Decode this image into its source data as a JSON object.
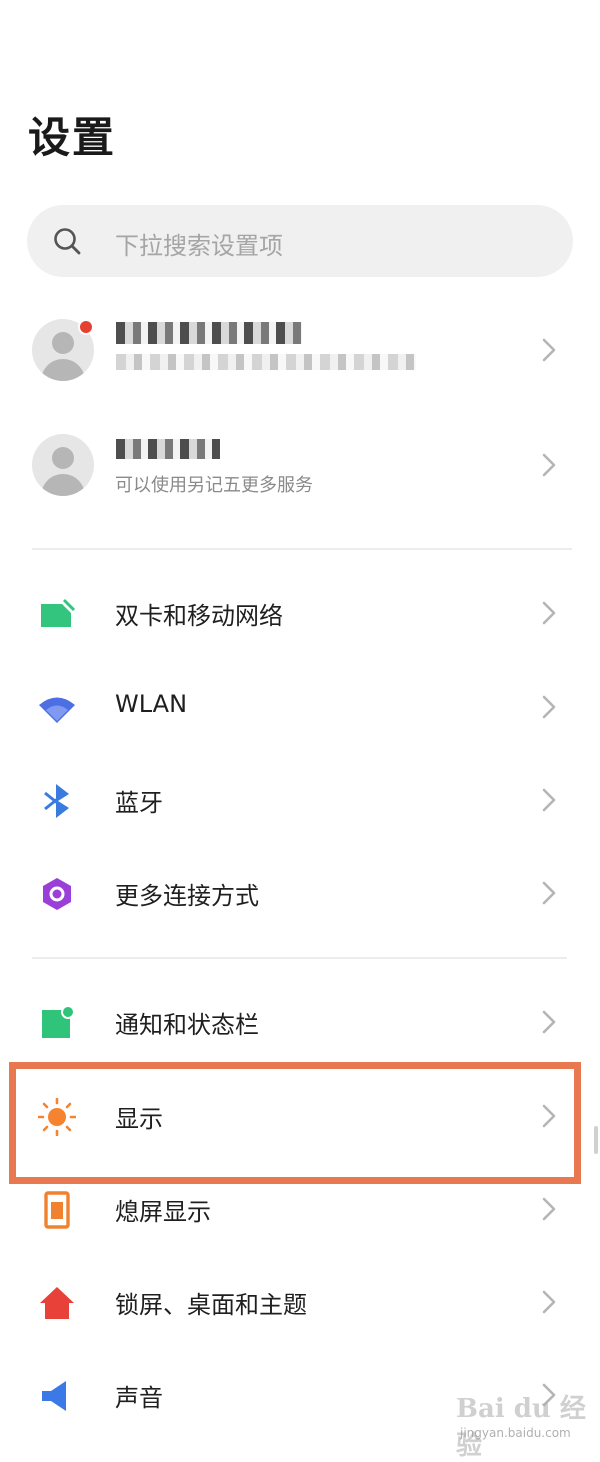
{
  "title": "设置",
  "search": {
    "placeholder": "下拉搜索设置项",
    "icon": "search-icon"
  },
  "accounts": [
    {
      "icon": "avatar",
      "has_notification": true
    },
    {
      "icon": "avatar",
      "subtitle": "可以使用另记五更多服务"
    }
  ],
  "section1": [
    {
      "label": "双卡和移动网络",
      "icon": "sim-card-icon",
      "color": "#33c47d"
    },
    {
      "label": "WLAN",
      "icon": "wifi-icon",
      "color": "#4d6fe3"
    },
    {
      "label": "蓝牙",
      "icon": "bluetooth-icon",
      "color": "#3a7be0"
    },
    {
      "label": "更多连接方式",
      "icon": "connection-hexagon-icon",
      "color": "#9b3fd9"
    }
  ],
  "section2": [
    {
      "label": "通知和状态栏",
      "icon": "notification-icon",
      "color": "#2fc47a"
    },
    {
      "label": "显示",
      "icon": "sun-icon",
      "color": "#f5832f"
    },
    {
      "label": "熄屏显示",
      "icon": "phone-screen-icon",
      "color": "#f0812e"
    },
    {
      "label": "锁屏、桌面和主题",
      "icon": "home-icon",
      "color": "#e8413a"
    },
    {
      "label": "声音",
      "icon": "speaker-icon",
      "color": "#3b79e6"
    }
  ],
  "highlight_color": "#e8784f",
  "watermark": {
    "brand": "Bai du 经验",
    "url": "jingyan.baidu.com"
  }
}
